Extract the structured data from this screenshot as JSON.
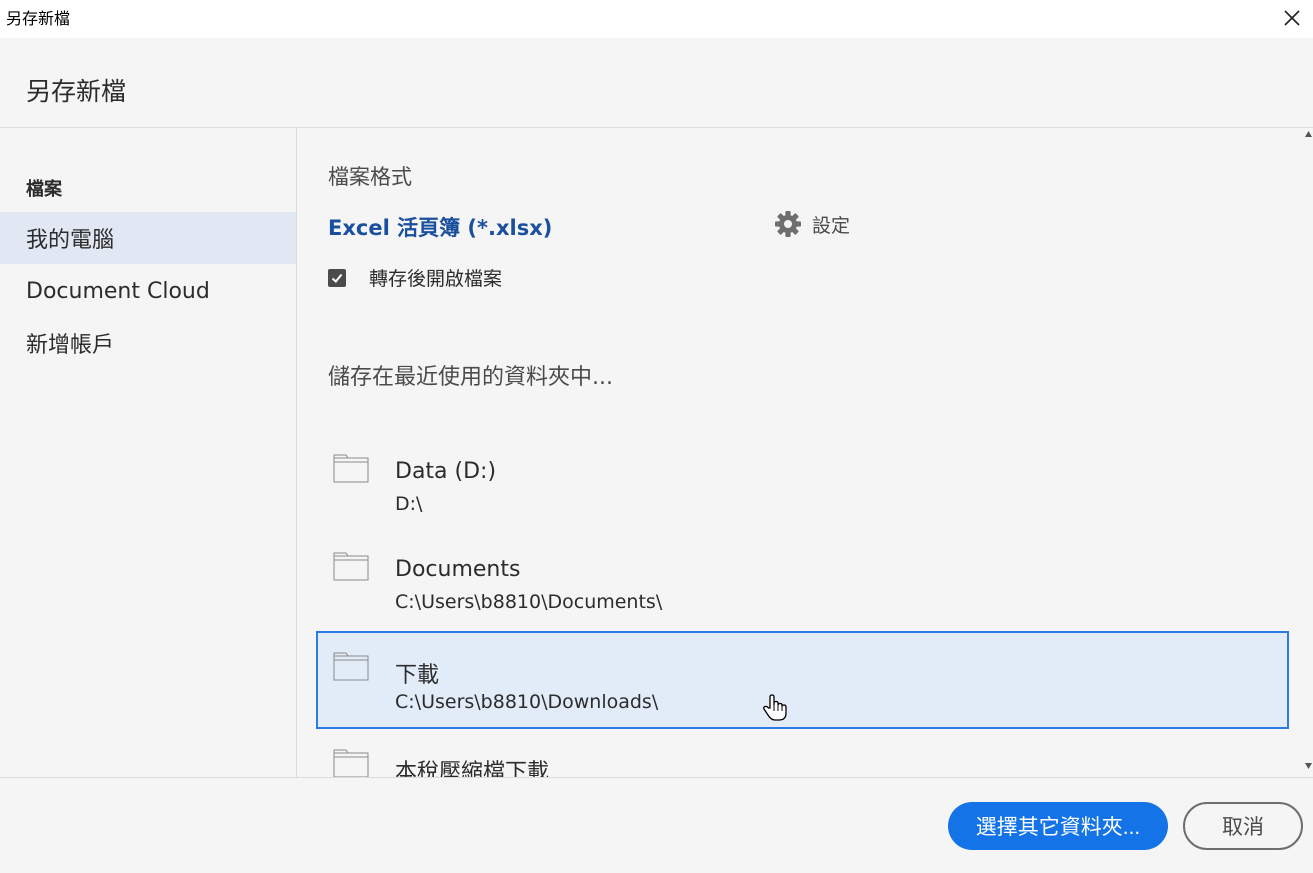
{
  "window": {
    "title": "另存新檔"
  },
  "header": {
    "title": "另存新檔"
  },
  "sidebar": {
    "section_label": "檔案",
    "items": [
      {
        "label": "我的電腦",
        "active": true
      },
      {
        "label": "Document Cloud",
        "active": false
      },
      {
        "label": "新增帳戶",
        "active": false
      }
    ]
  },
  "format": {
    "label": "檔案格式",
    "name": "Excel 活頁簿 (*.xlsx)",
    "settings_label": "設定"
  },
  "open_after": {
    "label": "轉存後開啟檔案",
    "checked": true
  },
  "recent": {
    "label": "儲存在最近使用的資料夾中...",
    "folders": [
      {
        "name": "Data (D:)",
        "path": "D:\\"
      },
      {
        "name": "Documents",
        "path": "C:\\Users\\b8810\\Documents\\"
      },
      {
        "name": "下載",
        "path": "C:\\Users\\b8810\\Downloads\\",
        "selected": true
      },
      {
        "name": "本稅壓縮檔下載",
        "path": ""
      }
    ]
  },
  "footer": {
    "choose_label": "選擇其它資料夾...",
    "cancel_label": "取消"
  },
  "colors": {
    "accent": "#1473e6",
    "selection_border": "#2c7be5",
    "selection_bg": "#e1ecf8",
    "format_text": "#1a4f9e"
  }
}
